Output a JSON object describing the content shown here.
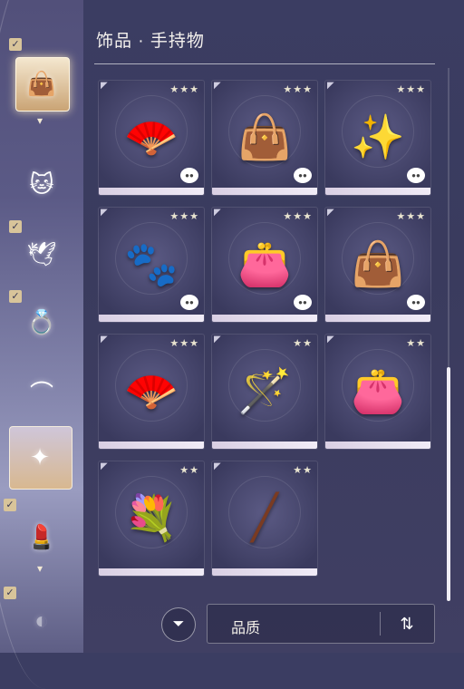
{
  "header": {
    "title": "饰品 · 手持物"
  },
  "sidebar": {
    "items": [
      {
        "name": "bag",
        "icon": "bag-icon",
        "glyph": "👜",
        "selected": true,
        "checked": true
      },
      {
        "name": "cat-ears",
        "icon": "cat-ears-icon",
        "glyph": "🐱",
        "selected": false,
        "checked": false
      },
      {
        "name": "wings",
        "icon": "wings-icon",
        "glyph": "🕊",
        "selected": false,
        "checked": true
      },
      {
        "name": "ring",
        "icon": "ring-icon",
        "glyph": "💍",
        "selected": false,
        "checked": true
      },
      {
        "name": "earring",
        "icon": "earring-icon",
        "glyph": "⌒",
        "selected": false,
        "checked": false
      },
      {
        "name": "handheld",
        "icon": "wand-icon",
        "glyph": "✦",
        "selected": true,
        "checked": false
      },
      {
        "name": "makeup",
        "icon": "makeup-icon",
        "glyph": "💄",
        "selected": false,
        "checked": true
      },
      {
        "name": "more",
        "icon": "more-icon",
        "glyph": "◐",
        "selected": false,
        "checked": true
      }
    ]
  },
  "grid": {
    "items": [
      {
        "name": "lace-fan",
        "icon": "lace-fan-icon",
        "glyph": "🪭",
        "stars": "★★★",
        "dye": true,
        "color": "#cfe0ee"
      },
      {
        "name": "red-basket-bag",
        "icon": "basket-bag-icon",
        "glyph": "👜",
        "stars": "★★★",
        "dye": true,
        "color": "#a23b2b"
      },
      {
        "name": "star-wand",
        "icon": "star-wand-icon",
        "glyph": "✨",
        "stars": "★★★",
        "dye": true,
        "color": "#dfe6f0"
      },
      {
        "name": "cat-face-fan",
        "icon": "cat-fan-icon",
        "glyph": "🐾",
        "stars": "★★★",
        "dye": true,
        "color": "#f0c6c6"
      },
      {
        "name": "olive-handbag",
        "icon": "handbag-icon",
        "glyph": "👛",
        "stars": "★★★",
        "dye": true,
        "color": "#7a7358"
      },
      {
        "name": "plaid-handbag",
        "icon": "plaid-bag-icon",
        "glyph": "👜",
        "stars": "★★★",
        "dye": true,
        "color": "#c89862"
      },
      {
        "name": "red-folding-fan",
        "icon": "folding-fan-icon",
        "glyph": "🪭",
        "stars": "★★★",
        "dye": false,
        "color": "#b93324"
      },
      {
        "name": "pink-wand",
        "icon": "pink-wand-icon",
        "glyph": "🪄",
        "stars": "★★",
        "dye": false,
        "color": "#e9b7c4"
      },
      {
        "name": "mint-quilted-bag",
        "icon": "quilted-bag-icon",
        "glyph": "👛",
        "stars": "★★",
        "dye": false,
        "color": "#cfe2dd"
      },
      {
        "name": "lavender-bouquet",
        "icon": "lavender-icon",
        "glyph": "💐",
        "stars": "★★",
        "dye": false,
        "color": "#9a7bd0"
      },
      {
        "name": "brown-stick",
        "icon": "stick-icon",
        "glyph": "╱",
        "stars": "★★",
        "dye": false,
        "color": "#7a3b22"
      }
    ]
  },
  "bottom": {
    "filter_icon": "filter-icon",
    "sort_label": "品质",
    "sort_icon": "sort-toggle-icon"
  }
}
